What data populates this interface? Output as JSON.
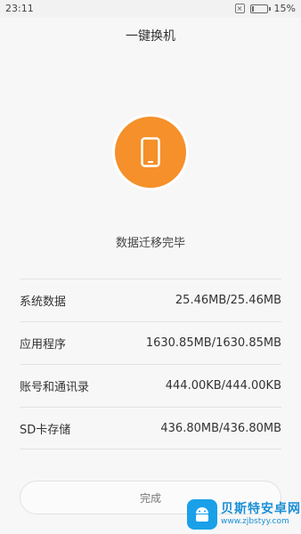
{
  "status_bar": {
    "time": "23:11",
    "battery_text": "15%",
    "battery_level": 0.15
  },
  "header": {
    "title": "一键换机"
  },
  "main": {
    "icon": "phone-icon",
    "status_text": "数据迁移完毕",
    "items": [
      {
        "label": "系统数据",
        "value": "25.46MB/25.46MB"
      },
      {
        "label": "应用程序",
        "value": "1630.85MB/1630.85MB"
      },
      {
        "label": "账号和通讯录",
        "value": "444.00KB/444.00KB"
      },
      {
        "label": "SD卡存储",
        "value": "436.80MB/436.80MB"
      }
    ],
    "done_label": "完成"
  },
  "watermark": {
    "title": "贝斯特安卓网",
    "url": "www.zjbstyy.com"
  },
  "colors": {
    "accent": "#f5902a",
    "watermark": "#1a8fd6"
  }
}
